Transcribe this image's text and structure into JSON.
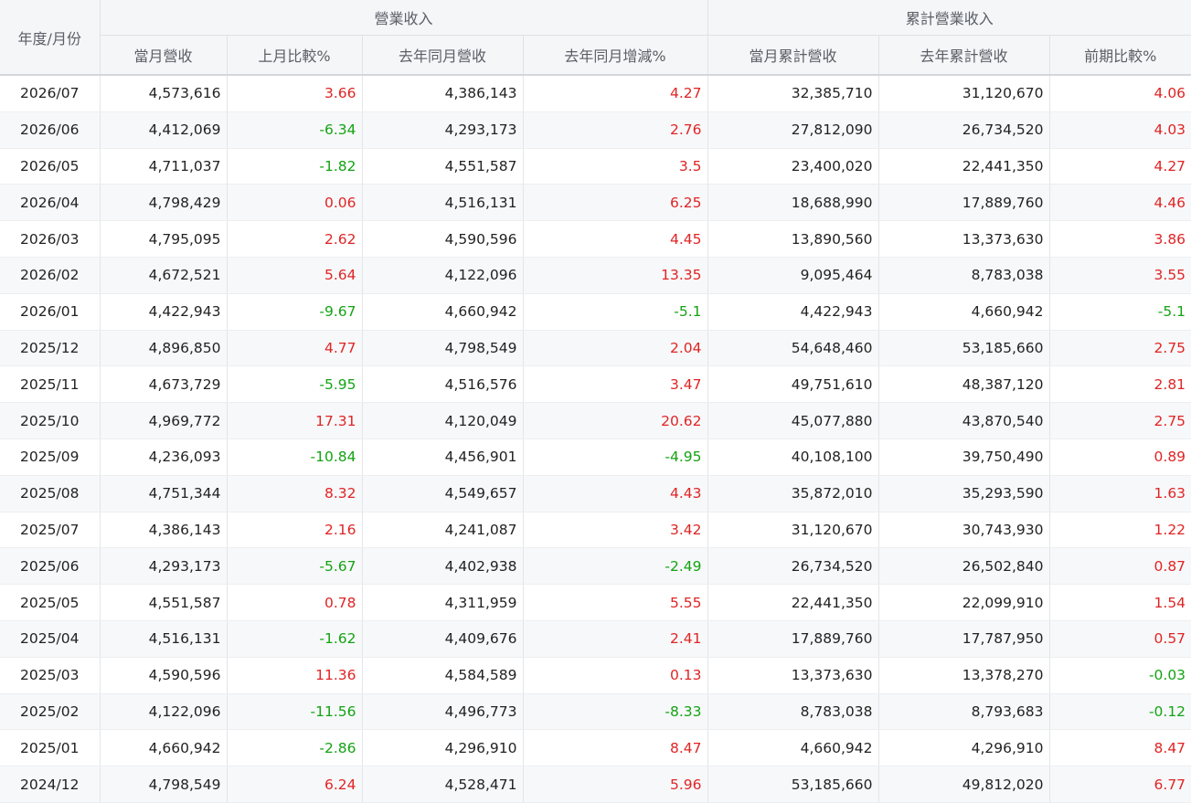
{
  "header": {
    "period": "年度/月份",
    "group_revenue": "營業收入",
    "group_cumulative": "累計營業收入",
    "columns": [
      "當月營收",
      "上月比較%",
      "去年同月營收",
      "去年同月增減%",
      "當月累計營收",
      "去年累計營收",
      "前期比較%"
    ]
  },
  "colors": {
    "positive": "#e02424",
    "negative": "#13a313"
  },
  "rows": [
    [
      "2026/07",
      "4,573,616",
      "3.66",
      "4,386,143",
      "4.27",
      "32,385,710",
      "31,120,670",
      "4.06"
    ],
    [
      "2026/06",
      "4,412,069",
      "-6.34",
      "4,293,173",
      "2.76",
      "27,812,090",
      "26,734,520",
      "4.03"
    ],
    [
      "2026/05",
      "4,711,037",
      "-1.82",
      "4,551,587",
      "3.5",
      "23,400,020",
      "22,441,350",
      "4.27"
    ],
    [
      "2026/04",
      "4,798,429",
      "0.06",
      "4,516,131",
      "6.25",
      "18,688,990",
      "17,889,760",
      "4.46"
    ],
    [
      "2026/03",
      "4,795,095",
      "2.62",
      "4,590,596",
      "4.45",
      "13,890,560",
      "13,373,630",
      "3.86"
    ],
    [
      "2026/02",
      "4,672,521",
      "5.64",
      "4,122,096",
      "13.35",
      "9,095,464",
      "8,783,038",
      "3.55"
    ],
    [
      "2026/01",
      "4,422,943",
      "-9.67",
      "4,660,942",
      "-5.1",
      "4,422,943",
      "4,660,942",
      "-5.1"
    ],
    [
      "2025/12",
      "4,896,850",
      "4.77",
      "4,798,549",
      "2.04",
      "54,648,460",
      "53,185,660",
      "2.75"
    ],
    [
      "2025/11",
      "4,673,729",
      "-5.95",
      "4,516,576",
      "3.47",
      "49,751,610",
      "48,387,120",
      "2.81"
    ],
    [
      "2025/10",
      "4,969,772",
      "17.31",
      "4,120,049",
      "20.62",
      "45,077,880",
      "43,870,540",
      "2.75"
    ],
    [
      "2025/09",
      "4,236,093",
      "-10.84",
      "4,456,901",
      "-4.95",
      "40,108,100",
      "39,750,490",
      "0.89"
    ],
    [
      "2025/08",
      "4,751,344",
      "8.32",
      "4,549,657",
      "4.43",
      "35,872,010",
      "35,293,590",
      "1.63"
    ],
    [
      "2025/07",
      "4,386,143",
      "2.16",
      "4,241,087",
      "3.42",
      "31,120,670",
      "30,743,930",
      "1.22"
    ],
    [
      "2025/06",
      "4,293,173",
      "-5.67",
      "4,402,938",
      "-2.49",
      "26,734,520",
      "26,502,840",
      "0.87"
    ],
    [
      "2025/05",
      "4,551,587",
      "0.78",
      "4,311,959",
      "5.55",
      "22,441,350",
      "22,099,910",
      "1.54"
    ],
    [
      "2025/04",
      "4,516,131",
      "-1.62",
      "4,409,676",
      "2.41",
      "17,889,760",
      "17,787,950",
      "0.57"
    ],
    [
      "2025/03",
      "4,590,596",
      "11.36",
      "4,584,589",
      "0.13",
      "13,373,630",
      "13,378,270",
      "-0.03"
    ],
    [
      "2025/02",
      "4,122,096",
      "-11.56",
      "4,496,773",
      "-8.33",
      "8,783,038",
      "8,793,683",
      "-0.12"
    ],
    [
      "2025/01",
      "4,660,942",
      "-2.86",
      "4,296,910",
      "8.47",
      "4,660,942",
      "4,296,910",
      "8.47"
    ],
    [
      "2024/12",
      "4,798,549",
      "6.24",
      "4,528,471",
      "5.96",
      "53,185,660",
      "49,812,020",
      "6.77"
    ]
  ]
}
